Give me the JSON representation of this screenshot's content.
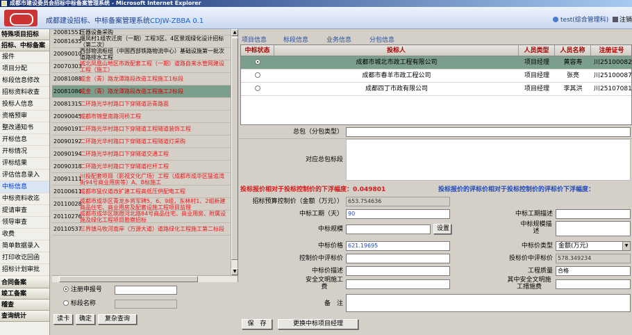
{
  "window": {
    "title": "成都市建设委员会招标中标备案管理系统 - Microsoft Internet Explorer"
  },
  "header": {
    "app_title": "成都建设招标、中标备案管理系统",
    "app_code": "CDJW-ZBBA 0.1",
    "user": "test(综合管理科)",
    "logout": "注销"
  },
  "nav": {
    "sec1": "特殊项目招标",
    "sec2": "招标、中标备案",
    "items": [
      "报件",
      "项目分配",
      "标段信息修改",
      "招标资料收查",
      "投标人信息",
      "资格预审",
      "整改通知书",
      "开标信息",
      "开标情况",
      "评标结果",
      "评估信息录入",
      "中标信息",
      "中标资料收迄",
      "提请审查",
      "领导审查",
      "收费",
      "简单数据录入",
      "打印收讫回函",
      "招标计划审批"
    ],
    "sec3": "合同备案",
    "sec4": "竣工备案",
    "sec5": "稽查",
    "sec6": "查询统计"
  },
  "list": [
    {
      "code": "20081551",
      "name": "压器设备采购",
      "style": "blk",
      "h": 9
    },
    {
      "code": "20081635",
      "name": "堰凤村1组农迁房（一期）工程3区、4区景观绿化设计招标（第二次）",
      "style": "blk",
      "h": 18
    },
    {
      "code": "20090010",
      "name": "西部物流枢纽（中国西部铁路物流中心）基础设施第一批次道路排水工程",
      "style": "blk",
      "h": 18
    },
    {
      "code": "20070303",
      "name": "城北凤凰山地区市政配套工程（一期）道路自来水管网建设工程（施工）",
      "style": "red",
      "h": 18
    },
    {
      "code": "20081088",
      "name": "成金（青）路龙潭路段改造工程施工1标段",
      "style": "red",
      "h": 18
    },
    {
      "code": "20081086",
      "name": "成金（青）路龙潭路段改造工程施工2标段",
      "style": "red",
      "h": 18,
      "selected": true
    },
    {
      "code": "20081315",
      "name": "二环路光华村路口下穿隧道沥青路面",
      "style": "red",
      "h": 18
    },
    {
      "code": "20090045",
      "name": "成都市锦里南路河桥工程",
      "style": "red",
      "h": 18
    },
    {
      "code": "20090191",
      "name": "二环路光华村路口下穿隧道工程隧道装饰工程",
      "style": "red",
      "h": 18
    },
    {
      "code": "20090192",
      "name": "二环路光华村路口下穿隧道工程隧道灯采购",
      "style": "red",
      "h": 18
    },
    {
      "code": "20090194",
      "name": "二环路光华村路口下穿隧道交通工程",
      "style": "red",
      "h": 18
    },
    {
      "code": "20090318",
      "name": "二环路光华村路口下穿隧道栏杆工程",
      "style": "red",
      "h": 18
    },
    {
      "code": "20091111",
      "name": "川投配套项目（影视文化广场）工程（成都市成华区猛追湾街94号商业用房等）A、B标施工",
      "style": "red",
      "h": 18
    },
    {
      "code": "20100611",
      "name": "成都市猛仪道改扩建工程高低压供配电工程",
      "style": "red",
      "h": 18
    },
    {
      "code": "20110028",
      "name": "成都市成华区青龙乡将军碑5、6、9组，东林村1、2组新建商品住宅、商业用房及配套设施工程项目监理",
      "style": "red",
      "h": 18
    },
    {
      "code": "20110276",
      "name": "成都市成华区跳蹬河北路84号商品住宅、商业用房、附属设施及绿化工程项目勘察招标",
      "style": "red",
      "h": 18
    },
    {
      "code": "20110537",
      "name": "三界镇马牧河南岸（万源大道）道路绿化工程施工第二标段",
      "style": "red",
      "h": 18
    }
  ],
  "search": {
    "opt1": "注册申报号",
    "opt2": "标段名称",
    "btn_card": "读卡",
    "btn_ok": "确定",
    "btn_reset": "复杂查询"
  },
  "tabs": [
    "项目信息",
    "标段信息",
    "业务信息",
    "分包信息"
  ],
  "grid": {
    "headers": [
      "中标状态",
      "投标人",
      "人员类型",
      "人员名称",
      "注册证号"
    ],
    "rows": [
      {
        "checked": true,
        "bidder": "成都市城北市政工程有限公司",
        "type": "项目经理",
        "name": "黄容寿",
        "cert": "川251000822",
        "selected": true
      },
      {
        "checked": false,
        "bidder": "成都市春羊市政工程公司",
        "type": "项目经理",
        "name": "张亮",
        "cert": "川251000876"
      },
      {
        "checked": false,
        "bidder": "成都四丁市政有限公司",
        "type": "项目经理",
        "name": "李其洪",
        "cert": "川251070814"
      }
    ]
  },
  "form": {
    "label_package": "总包（分包类型）",
    "label_corr": "对应总包标段",
    "hl_left_label": "投标报价相对于投标控制价的下浮幅度：",
    "hl_left_value": "0.049801",
    "hl_right_label": "投标报价的评标价相对于投标控制价的评标价下浮幅度：",
    "label_budget": "招标预算控制价（金额（万元））",
    "budget_value": "653.754636",
    "label_duration": "中标工期（天）",
    "duration_value": "90",
    "label_duration_desc": "中标工期描述",
    "label_scale": "中标规模",
    "btn_settings": "设置",
    "label_scale_desc": "中标规模描述",
    "label_price": "中标价格",
    "price_value": "621.19695",
    "label_price_type": "中标价类型",
    "price_type_value": "金额(万元)",
    "label_ctrl_eval": "控制价中评标价",
    "label_bid_eval": "投标价中评标价",
    "bid_eval_value": "578.349234",
    "label_price_desc": "中标价描述",
    "label_quality": "工程质量",
    "quality_value": "合格",
    "label_safety": "安全文明施工费",
    "label_safety_measures": "其中安全文明施工措施费",
    "label_remarks": "备　注",
    "btn_save": "保　存",
    "btn_change": "更换中标项目经理"
  }
}
